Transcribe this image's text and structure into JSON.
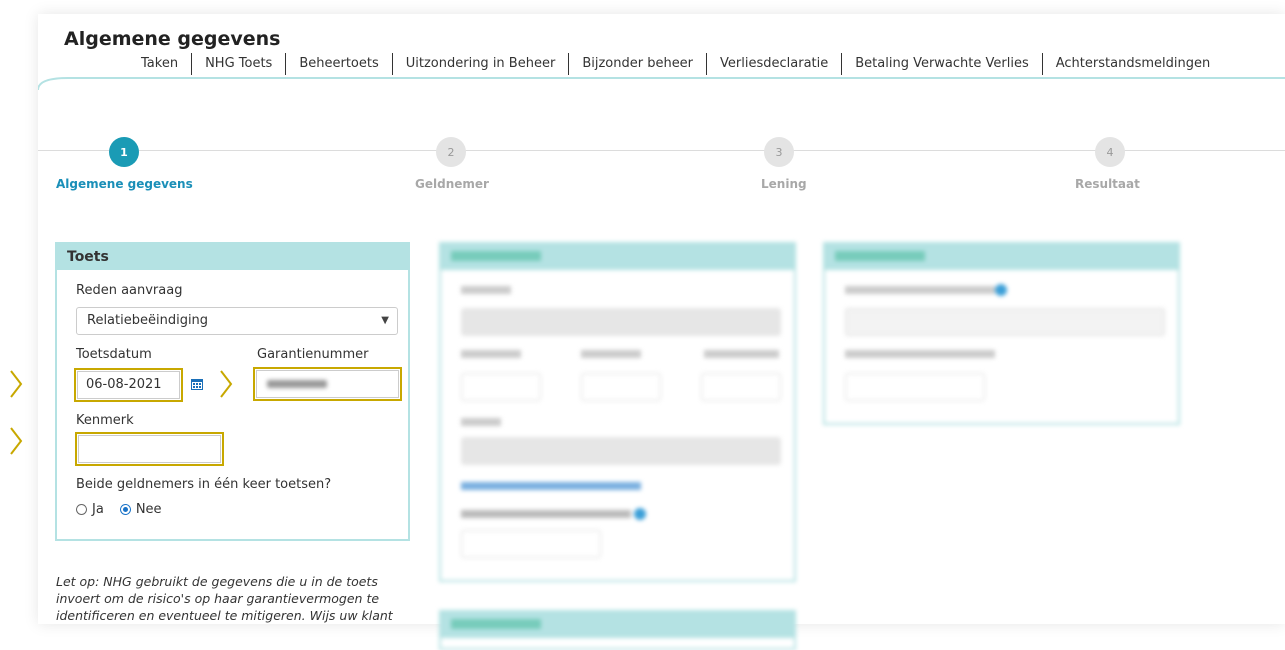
{
  "page": {
    "title": "Algemene gegevens",
    "tabs": [
      "Taken",
      "NHG Toets",
      "Beheertoets",
      "Uitzondering in Beheer",
      "Bijzonder beheer",
      "Verliesdeclaratie",
      "Betaling Verwachte Verlies",
      "Achterstandsmeldingen"
    ]
  },
  "stepper": [
    {
      "num": "1",
      "label": "Algemene gegevens",
      "active": true
    },
    {
      "num": "2",
      "label": "Geldnemer",
      "active": false
    },
    {
      "num": "3",
      "label": "Lening",
      "active": false
    },
    {
      "num": "4",
      "label": "Resultaat",
      "active": false
    }
  ],
  "toets": {
    "title": "Toets",
    "reden_label": "Reden aanvraag",
    "reden_value": "Relatiebeëindiging",
    "toetsdatum_label": "Toetsdatum",
    "toetsdatum_value": "06-08-2021",
    "garantienummer_label": "Garantienummer",
    "garantienummer_value": "",
    "kenmerk_label": "Kenmerk",
    "kenmerk_value": "",
    "beide_label": "Beide geldnemers in één keer toetsen?",
    "radio_ja": "Ja",
    "radio_nee": "Nee",
    "selected": "Nee"
  },
  "note": {
    "text": "Let op: NHG gebruikt de gegevens die u in de toets invoert om de risico's op haar garantievermogen te identificeren en eventueel te mitigeren. Wijs uw klant"
  },
  "colors": {
    "accent": "#1a9bb5",
    "panel_head": "#b4e2e3",
    "highlight": "#c8a800"
  }
}
